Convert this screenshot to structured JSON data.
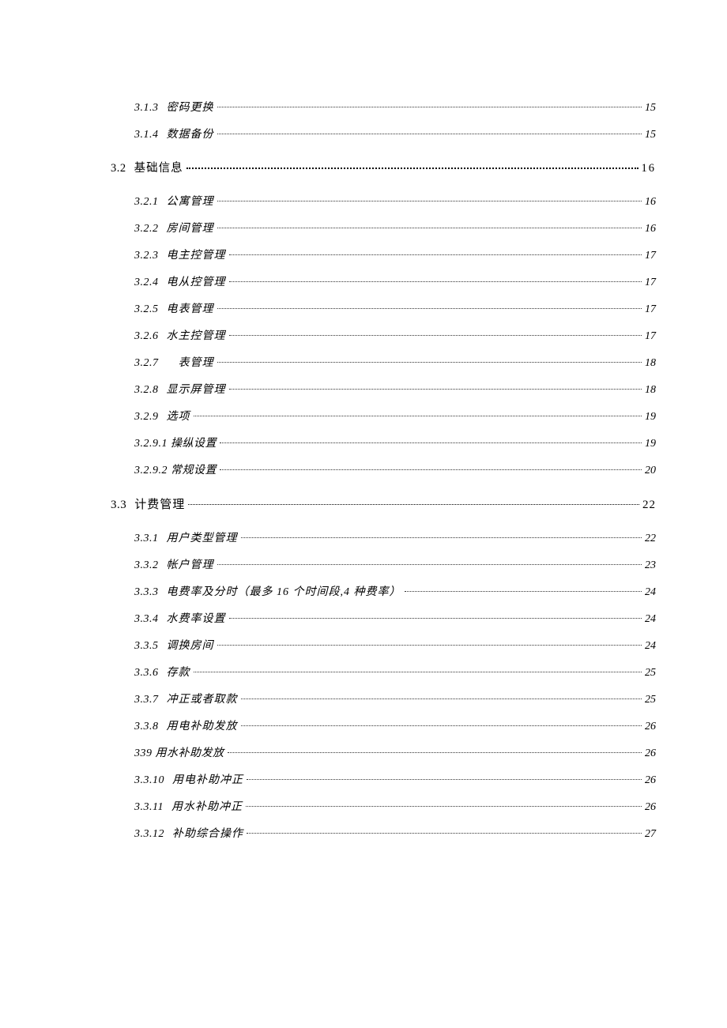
{
  "toc": [
    {
      "level": 3,
      "num": "3.1.3",
      "title": "密码更换",
      "page": "15"
    },
    {
      "level": 3,
      "num": "3.1.4",
      "title": "数据备份",
      "page": "15"
    },
    {
      "level": 2,
      "num": "3.2",
      "title": "基础信息",
      "page": "16",
      "style": "spaced"
    },
    {
      "level": 3,
      "num": "3.2.1",
      "title": "公寓管理",
      "page": "16"
    },
    {
      "level": 3,
      "num": "3.2.2",
      "title": "房间管理",
      "page": "16"
    },
    {
      "level": 3,
      "num": "3.2.3",
      "title": "电主控管理",
      "page": "17"
    },
    {
      "level": 3,
      "num": "3.2.4",
      "title": "电从控管理",
      "page": "17"
    },
    {
      "level": 3,
      "num": "3.2.5",
      "title": "电表管理",
      "page": "17"
    },
    {
      "level": 3,
      "num": "3.2.6",
      "title": "水主控管理",
      "page": "17"
    },
    {
      "level": 3,
      "num": "3.2.7",
      "title": "　表管理",
      "page": "18"
    },
    {
      "level": 3,
      "num": "3.2.8",
      "title": "显示屏管理",
      "page": "18"
    },
    {
      "level": 3,
      "num": "3.2.9",
      "title": "选项",
      "page": "19"
    },
    {
      "level": 4,
      "num": "3.2.9.1",
      "title": "操纵设置",
      "page": "19",
      "nonum_display": true
    },
    {
      "level": 4,
      "num": "3.2.9.2",
      "title": "常规设置",
      "page": "20",
      "nonum_display": true
    },
    {
      "level": 2,
      "num": "3.3",
      "title": "计费管理",
      "page": "22",
      "style": "bold"
    },
    {
      "level": 3,
      "num": "3.3.1",
      "title": "用户类型管理",
      "page": "22"
    },
    {
      "level": 3,
      "num": "3.3.2",
      "title": "帐户管理",
      "page": "23"
    },
    {
      "level": 3,
      "num": "3.3.3",
      "title": "电费率及分时（最多 16 个时间段,4 种费率）",
      "page": "24"
    },
    {
      "level": 3,
      "num": "3.3.4",
      "title": "水费率设置",
      "page": "24"
    },
    {
      "level": 3,
      "num": "3.3.5",
      "title": "调换房间",
      "page": "24"
    },
    {
      "level": 3,
      "num": "3.3.6",
      "title": "存款",
      "page": "25"
    },
    {
      "level": 3,
      "num": "3.3.7",
      "title": "冲正或者取款",
      "page": "25"
    },
    {
      "level": 3,
      "num": "3.3.8",
      "title": "用电补助发放",
      "page": "26"
    },
    {
      "level": 3,
      "num": "339",
      "title": "用水补助发放",
      "page": "26",
      "combined": true
    },
    {
      "level": 3,
      "num": "3.3.10",
      "title": "用电补助冲正",
      "page": "26"
    },
    {
      "level": 3,
      "num": "3.3.11",
      "title": "用水补助冲正",
      "page": "26"
    },
    {
      "level": 3,
      "num": "3.3.12",
      "title": "补助综合操作",
      "page": "27"
    }
  ]
}
